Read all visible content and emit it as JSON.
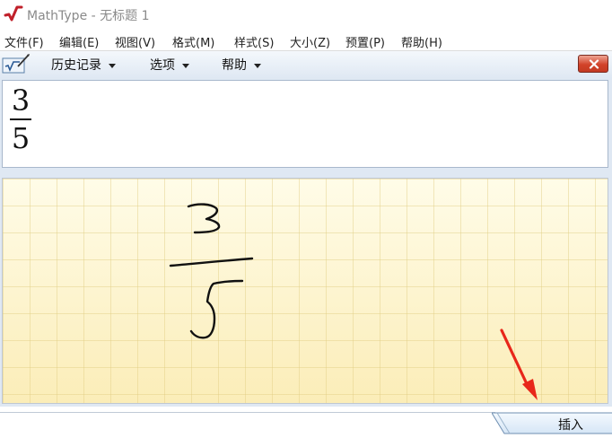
{
  "window": {
    "title": "MathType - 无标题 1",
    "logo_icon": "mathtype-logo-icon"
  },
  "menubar": {
    "items": [
      {
        "label": "文件(F)"
      },
      {
        "label": "编辑(E)"
      },
      {
        "label": "视图(V)"
      },
      {
        "label": "格式(M)"
      },
      {
        "label": "样式(S)"
      },
      {
        "label": "大小(Z)"
      },
      {
        "label": "预置(P)"
      },
      {
        "label": "帮助(H)"
      }
    ]
  },
  "math_input_panel": {
    "toolbar": {
      "icon": "math-input-panel-icon",
      "menus": [
        {
          "label": "历史记录"
        },
        {
          "label": "选项"
        },
        {
          "label": "帮助"
        }
      ],
      "close_icon": "close-icon"
    },
    "preview": {
      "numerator": "3",
      "denominator": "5"
    },
    "writing_pad": {
      "ink_description": "handwritten-fraction"
    },
    "insert_button": {
      "label": "插入"
    }
  },
  "annotation": {
    "arrow_color": "#e8271a",
    "target": "insert-button"
  },
  "colors": {
    "close_button": "#d2432a",
    "writing_pad": "#fcf3cc",
    "panel_bg": "#dfe8f3"
  }
}
